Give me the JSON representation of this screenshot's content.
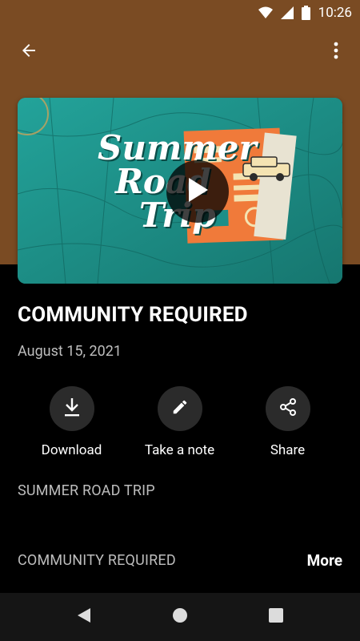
{
  "status_bar": {
    "time": "10:26",
    "icons": [
      "wifi-icon",
      "cell-signal-icon",
      "battery-icon"
    ]
  },
  "app_bar": {
    "back_icon": "arrow-left-icon",
    "menu_icon": "more-vert-icon"
  },
  "colors": {
    "header_bg": "#7a4b23",
    "hero_teal": "#1d8f88",
    "accent_orange": "#f07a3a"
  },
  "hero": {
    "artwork_text": [
      "Summer",
      "Road",
      "Trip"
    ],
    "play_icon": "play-icon"
  },
  "episode": {
    "title": "COMMUNITY REQUIRED",
    "date": "August 15, 2021"
  },
  "actions": [
    {
      "label": "Download",
      "icon": "download-icon"
    },
    {
      "label": "Take a note",
      "icon": "pencil-icon"
    },
    {
      "label": "Share",
      "icon": "share-icon"
    }
  ],
  "series_name": "SUMMER ROAD TRIP",
  "description": {
    "text": "COMMUNITY REQUIRED",
    "more_label": "More"
  },
  "nav_bar": {
    "icons": [
      "nav-back-icon",
      "nav-home-icon",
      "nav-recents-icon"
    ]
  }
}
